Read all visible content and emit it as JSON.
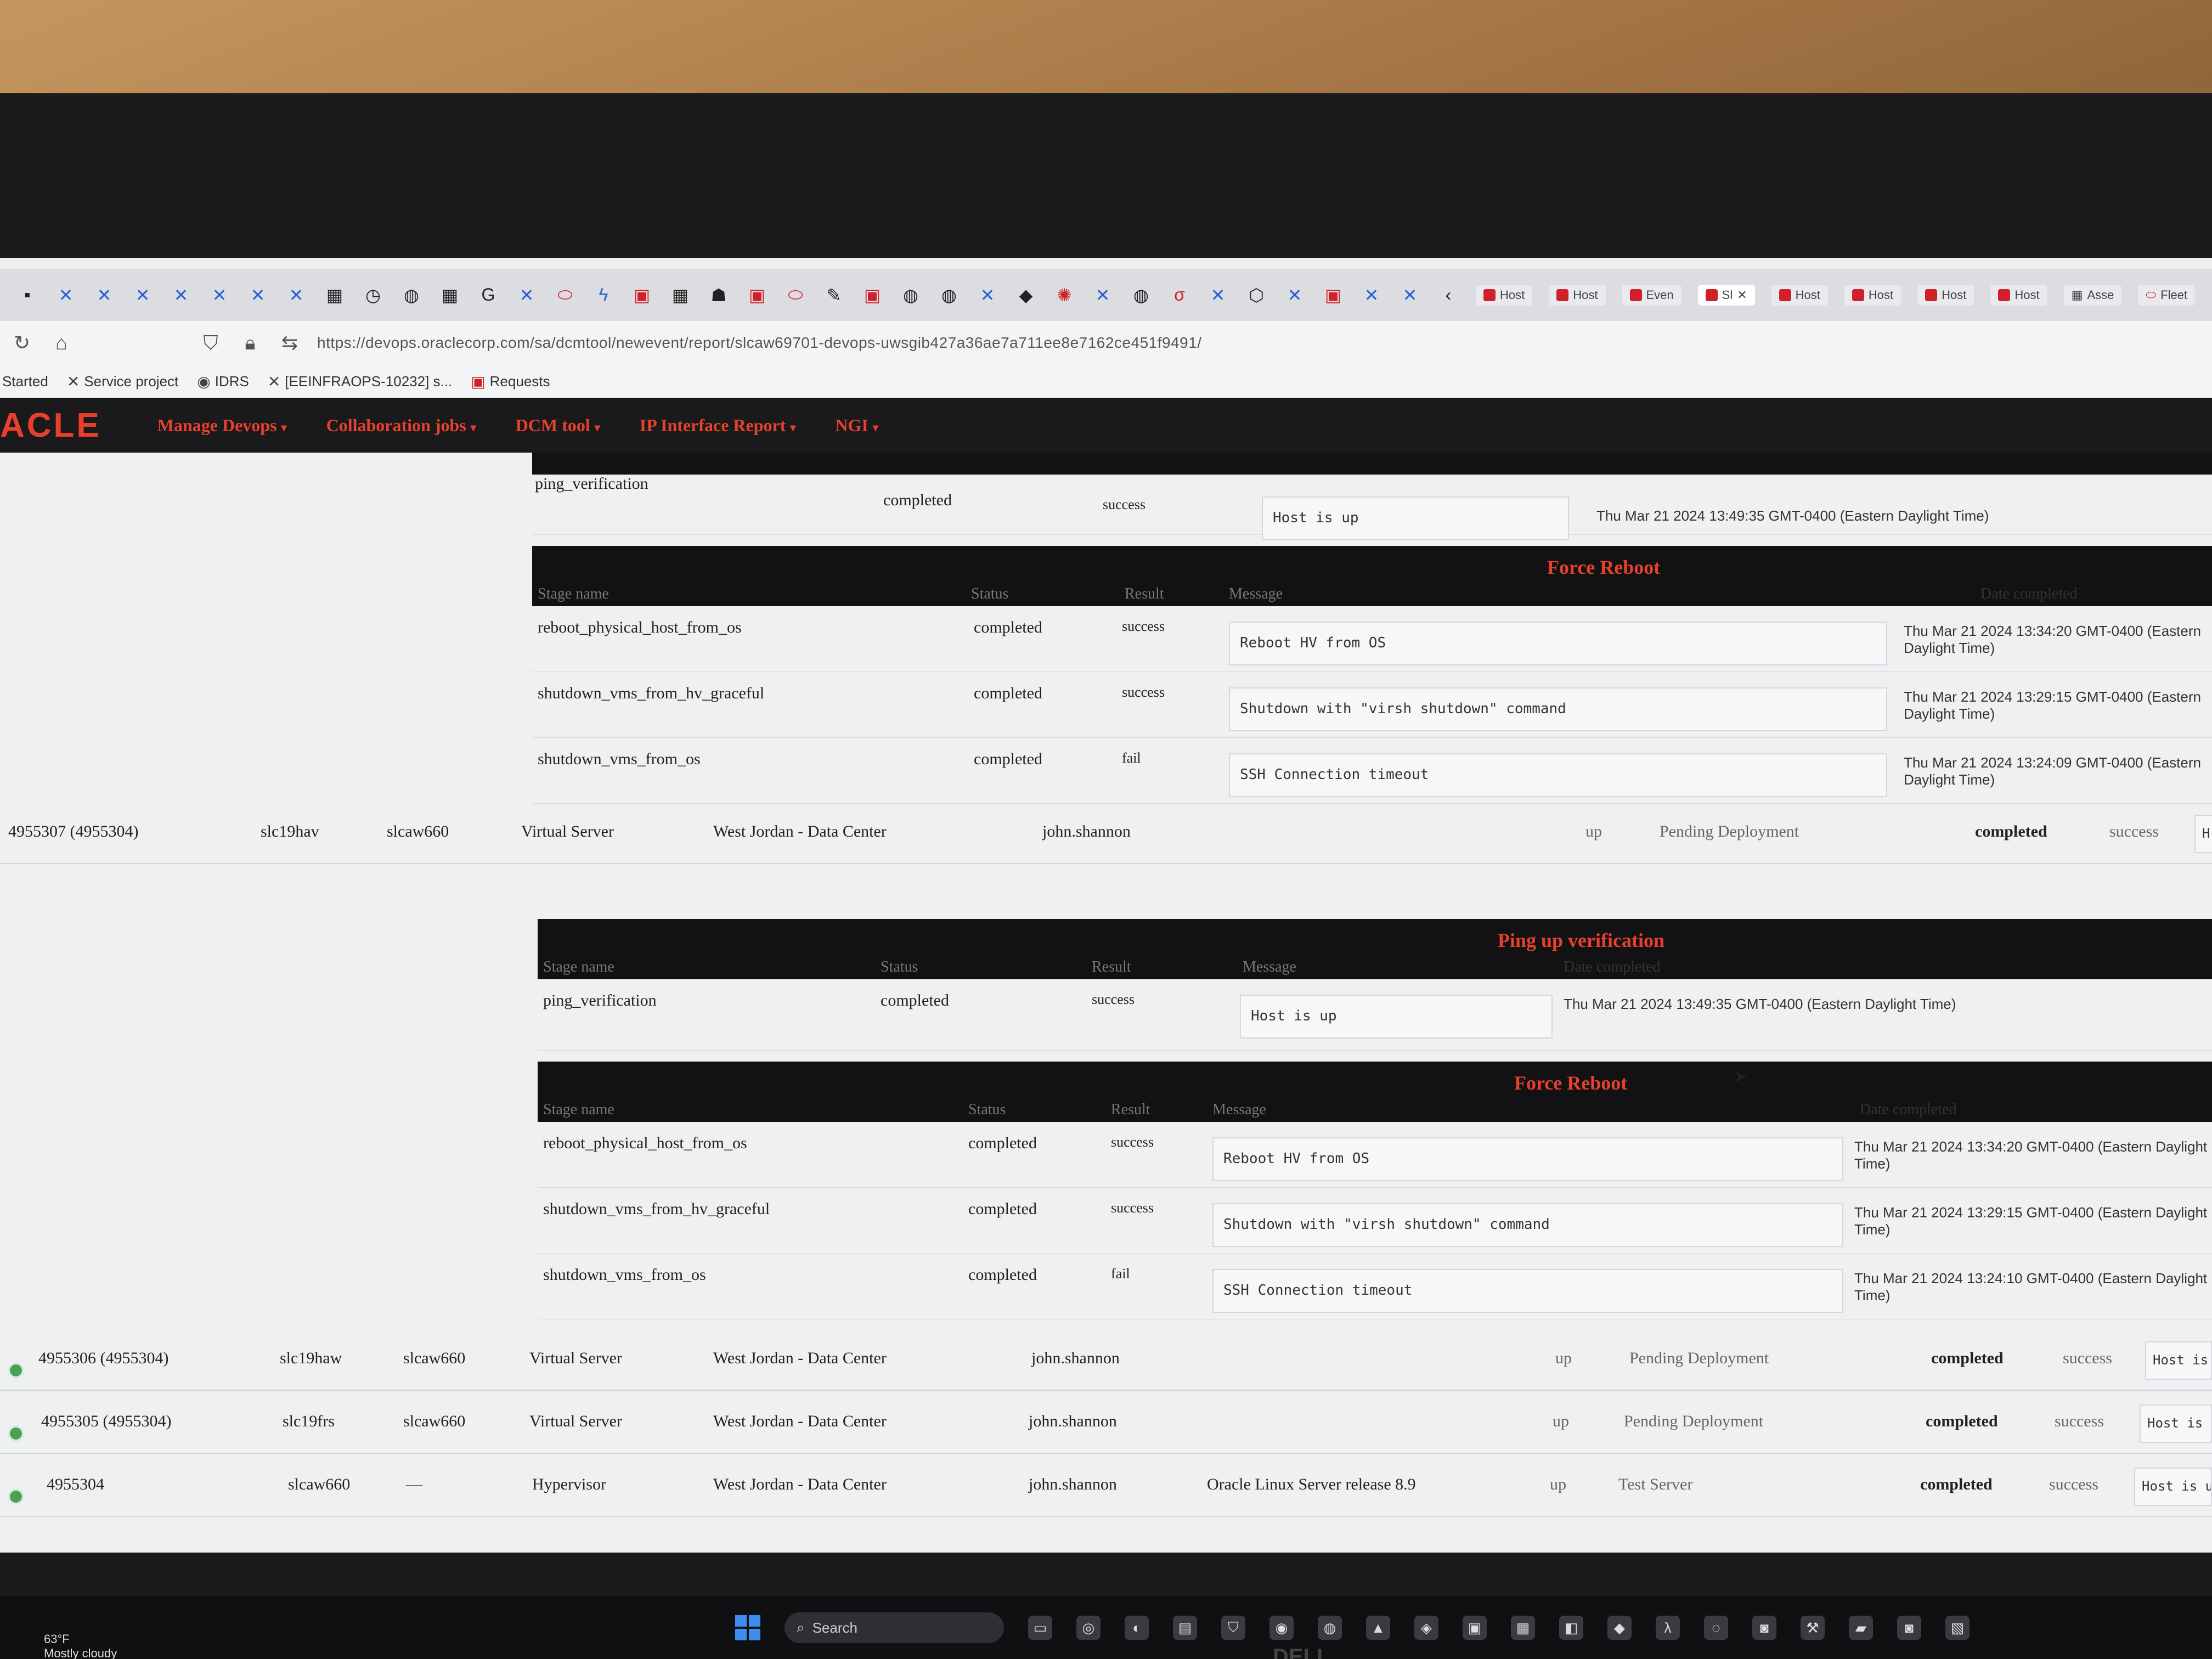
{
  "browser": {
    "tabs": [
      "Host",
      "Host",
      "Even",
      "Sl",
      "Host",
      "Host",
      "Host",
      "Host",
      "Asse",
      "Fleet"
    ],
    "active_tab_label": "Sl",
    "url": "https://devops.oraclecorp.com/sa/dcmtool/newevent/report/slcaw69701-devops-uwsgib427a36ae7a711ee8e7162ce451f9491/",
    "bookmarks": [
      "Started",
      "Service project",
      "IDRS",
      "[EEINFRAOPS-10232] s...",
      "Requests"
    ]
  },
  "app": {
    "logo": "ACLE",
    "nav": [
      "Manage Devops",
      "Collaboration jobs",
      "DCM tool",
      "IP Interface Report",
      "NGI"
    ]
  },
  "columns": {
    "stage_name": "Stage name",
    "status": "Status",
    "result": "Result",
    "message": "Message",
    "date_completed": "Date completed"
  },
  "top_partial": {
    "stage": "ping_verification",
    "status": "completed",
    "result": "success",
    "message": "Host is up",
    "date": "Thu Mar 21 2024 13:49:35 GMT-0400 (Eastern Daylight Time)"
  },
  "block1": {
    "title": "Force Reboot",
    "rows": [
      {
        "stage": "reboot_physical_host_from_os",
        "status": "completed",
        "result": "success",
        "message": "Reboot HV from OS",
        "date": "Thu Mar 21 2024 13:34:20 GMT-0400 (Eastern Daylight Time)"
      },
      {
        "stage": "shutdown_vms_from_hv_graceful",
        "status": "completed",
        "result": "success",
        "message": "Shutdown with \"virsh shutdown\" command",
        "date": "Thu Mar 21 2024 13:29:15 GMT-0400 (Eastern Daylight Time)"
      },
      {
        "stage": "shutdown_vms_from_os",
        "status": "completed",
        "result": "fail",
        "message": "SSH Connection timeout",
        "date": "Thu Mar 21 2024 13:24:09 GMT-0400 (Eastern Daylight Time)"
      }
    ]
  },
  "host1": {
    "id": "4955307 (4955304)",
    "name": "slc19hav",
    "parent": "slcaw660",
    "type": "Virtual Server",
    "location": "West Jordan - Data Center",
    "owner": "john.shannon",
    "os": "",
    "state": "up",
    "lifecycle": "Pending Deployment",
    "status": "completed",
    "result": "success",
    "message": "H"
  },
  "block2": {
    "title": "Ping up verification",
    "rows": [
      {
        "stage": "ping_verification",
        "status": "completed",
        "result": "success",
        "message": "Host is up",
        "date": "Thu Mar 21 2024 13:49:35 GMT-0400 (Eastern Daylight Time)"
      }
    ]
  },
  "block3": {
    "title": "Force Reboot",
    "rows": [
      {
        "stage": "reboot_physical_host_from_os",
        "status": "completed",
        "result": "success",
        "message": "Reboot HV from OS",
        "date": "Thu Mar 21 2024 13:34:20 GMT-0400 (Eastern Daylight Time)"
      },
      {
        "stage": "shutdown_vms_from_hv_graceful",
        "status": "completed",
        "result": "success",
        "message": "Shutdown with \"virsh shutdown\" command",
        "date": "Thu Mar 21 2024 13:29:15 GMT-0400 (Eastern Daylight Time)"
      },
      {
        "stage": "shutdown_vms_from_os",
        "status": "completed",
        "result": "fail",
        "message": "SSH Connection timeout",
        "date": "Thu Mar 21 2024 13:24:10 GMT-0400 (Eastern Daylight Time)"
      }
    ]
  },
  "hosts": [
    {
      "id": "4955306 (4955304)",
      "name": "slc19haw",
      "parent": "slcaw660",
      "type": "Virtual Server",
      "location": "West Jordan - Data Center",
      "owner": "john.shannon",
      "os": "",
      "state": "up",
      "lifecycle": "Pending Deployment",
      "status": "completed",
      "result": "success",
      "message": "Host is"
    },
    {
      "id": "4955305 (4955304)",
      "name": "slc19frs",
      "parent": "slcaw660",
      "type": "Virtual Server",
      "location": "West Jordan - Data Center",
      "owner": "john.shannon",
      "os": "",
      "state": "up",
      "lifecycle": "Pending Deployment",
      "status": "completed",
      "result": "success",
      "message": "Host is u"
    },
    {
      "id": "4955304",
      "name": "slcaw660",
      "parent": "—",
      "type": "Hypervisor",
      "location": "West Jordan - Data Center",
      "owner": "john.shannon",
      "os": "Oracle Linux Server release 8.9",
      "state": "up",
      "lifecycle": "Test Server",
      "status": "completed",
      "result": "success",
      "message": "Host is up"
    }
  ],
  "taskbar": {
    "search_placeholder": "Search",
    "weather_temp": "63°F",
    "weather_desc": "Mostly cloudy"
  },
  "monitor_brand": "DELL"
}
